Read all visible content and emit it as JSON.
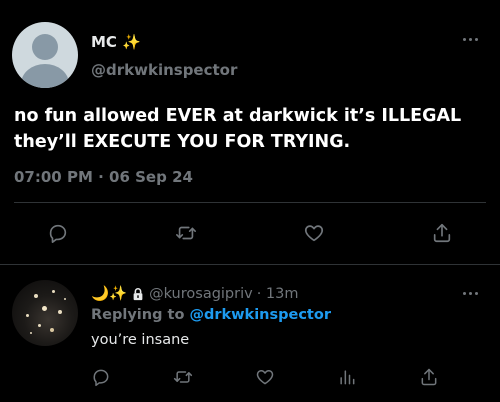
{
  "main_tweet": {
    "display_name": "MC",
    "name_emoji": "✨",
    "handle": "@drkwkinspector",
    "text": "no fun allowed EVER at darkwick it’s ILLEGAL they’ll EXECUTE YOU FOR TRYING.",
    "timestamp": "07:00 PM · 06 Sep 24",
    "avatar": "default-avatar",
    "actions": [
      "reply-icon",
      "retweet-icon",
      "like-icon",
      "share-icon"
    ],
    "more": "more-options-icon"
  },
  "reply_tweet": {
    "display_emoji": "🌙✨",
    "protected": "lock-icon",
    "handle": "@kurosagipriv",
    "time_ago": "· 13m",
    "replying_prefix": "Replying to",
    "replying_handle": "@drkwkinspector",
    "text": "you’re insane",
    "actions": [
      "reply-icon",
      "retweet-icon",
      "like-icon",
      "views-icon",
      "share-icon"
    ],
    "more": "more-options-icon"
  },
  "colors": {
    "background": "#000000",
    "text": "#e7e9ea",
    "secondary": "#71767b",
    "accent": "#1d9bf0",
    "divider": "#2f3336"
  }
}
